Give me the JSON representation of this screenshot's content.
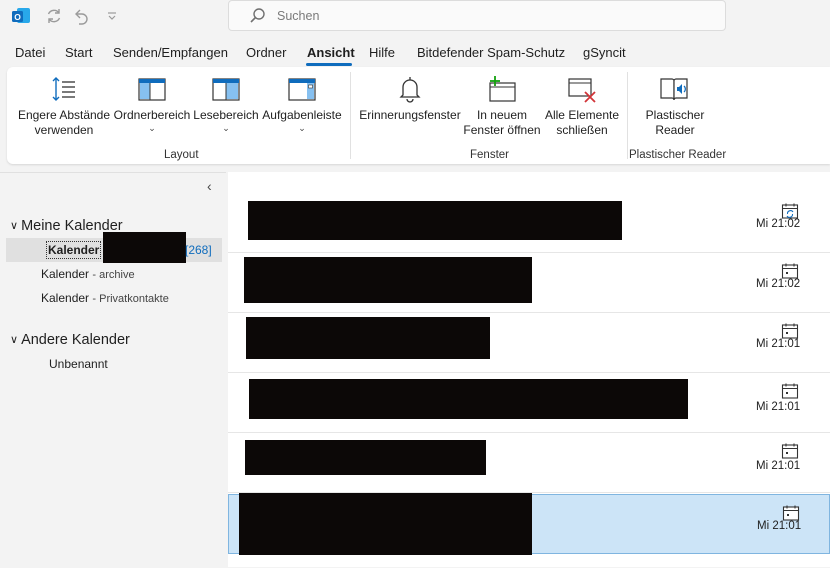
{
  "search": {
    "placeholder": "Suchen"
  },
  "menu": {
    "tabs": [
      "Datei",
      "Start",
      "Senden/Empfangen",
      "Ordner",
      "Ansicht",
      "Hilfe",
      "Bitdefender Spam-Schutz",
      "gSyncit"
    ],
    "active": "Ansicht"
  },
  "ribbon": {
    "layout": {
      "label": "Layout",
      "compact_line1": "Engere Abstände",
      "compact_line2": "verwenden",
      "folder_pane": "Ordnerbereich",
      "reading_pane": "Lesebereich",
      "todo_bar": "Aufgabenleiste"
    },
    "window": {
      "label": "Fenster",
      "reminders": "Erinnerungsfenster",
      "open_new_line1": "In neuem",
      "open_new_line2": "Fenster öffnen",
      "close_all_line1": "Alle Elemente",
      "close_all_line2": "schließen"
    },
    "immersive": {
      "label": "Plastischer Reader",
      "reader_line1": "Plastischer",
      "reader_line2": "Reader"
    }
  },
  "sidebar": {
    "my_calendars": "Meine Kalender",
    "items": [
      {
        "name": "Kalender",
        "count": "[268]"
      },
      {
        "name": "Kalender",
        "suffix": "- archive"
      },
      {
        "name": "Kalender",
        "suffix": "- Privatkontakte"
      }
    ],
    "other_calendars": "Andere Kalender",
    "other_items": [
      "Unbenannt"
    ]
  },
  "list": {
    "items": [
      {
        "time": "Mi 21:02",
        "icon": "calendar-recurring-icon",
        "selected": false
      },
      {
        "time": "Mi 21:02",
        "icon": "calendar-icon",
        "selected": false
      },
      {
        "time": "Mi 21:01",
        "icon": "calendar-icon",
        "selected": false
      },
      {
        "time": "Mi 21:01",
        "icon": "calendar-icon",
        "selected": false
      },
      {
        "time": "Mi 21:01",
        "icon": "calendar-icon",
        "selected": false
      },
      {
        "time": "Mi 21:01",
        "icon": "calendar-icon",
        "selected": true
      }
    ]
  },
  "colors": {
    "accent": "#0f6cbd",
    "selection": "#cce4f7",
    "redaction": "#0c0807"
  }
}
